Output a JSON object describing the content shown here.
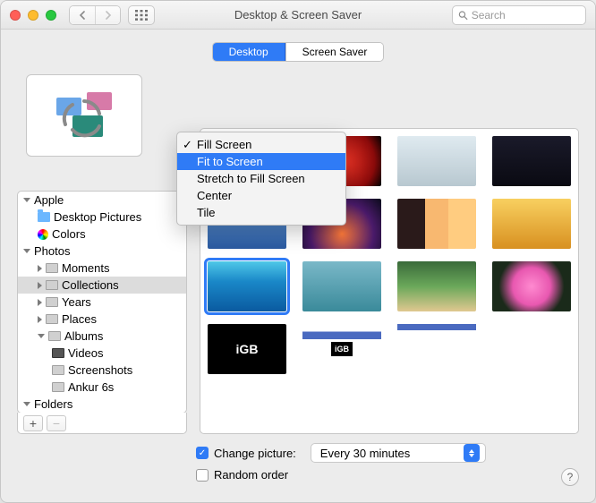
{
  "window": {
    "title": "Desktop & Screen Saver"
  },
  "search": {
    "placeholder": "Search"
  },
  "tabs": {
    "desktop": "Desktop",
    "screensaver": "Screen Saver",
    "active": "desktop"
  },
  "fit_menu": {
    "visible_control_label": "Fit to Screen",
    "items": [
      {
        "label": "Fill Screen",
        "checked": true,
        "selected": false
      },
      {
        "label": "Fit to Screen",
        "checked": false,
        "selected": true
      },
      {
        "label": "Stretch to Fill Screen",
        "checked": false,
        "selected": false
      },
      {
        "label": "Center",
        "checked": false,
        "selected": false
      },
      {
        "label": "Tile",
        "checked": false,
        "selected": false
      }
    ]
  },
  "sidebar": {
    "groups": [
      {
        "label": "Apple",
        "children": [
          {
            "label": "Desktop Pictures",
            "icon": "folder"
          },
          {
            "label": "Colors",
            "icon": "colors"
          }
        ]
      },
      {
        "label": "Photos",
        "children": [
          {
            "label": "Moments",
            "icon": "rect"
          },
          {
            "label": "Collections",
            "icon": "rect",
            "selected": true
          },
          {
            "label": "Years",
            "icon": "rect"
          },
          {
            "label": "Places",
            "icon": "rect"
          },
          {
            "label": "Albums",
            "icon": "rect",
            "expanded": true,
            "children": [
              {
                "label": "Videos",
                "icon": "rect"
              },
              {
                "label": "Screenshots",
                "icon": "rect"
              },
              {
                "label": "Ankur 6s",
                "icon": "rect"
              }
            ]
          }
        ]
      },
      {
        "label": "Folders"
      }
    ]
  },
  "options": {
    "change_picture_label": "Change picture:",
    "change_picture_checked": true,
    "interval": "Every 30 minutes",
    "random_order_label": "Random order",
    "random_order_checked": false
  },
  "thumbs": {
    "igb": "iGB"
  }
}
